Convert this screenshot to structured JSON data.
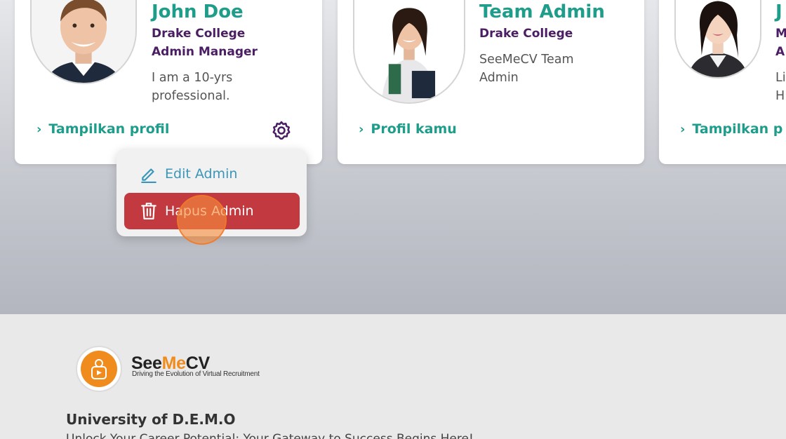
{
  "cards": [
    {
      "name": "John Doe",
      "org": "Drake College",
      "role": "Admin Manager",
      "desc": "I am a 10-yrs professional.",
      "link": "Tampilkan profil"
    },
    {
      "name": "Team Admin",
      "org": "Drake College",
      "role": "",
      "desc": "SeeMeCV Team Admin",
      "link": "Profil kamu"
    },
    {
      "name": "J",
      "org": "M",
      "role": "A",
      "desc": "Li H",
      "link": "Tampilkan p"
    }
  ],
  "menu": {
    "edit_label": "Edit Admin",
    "delete_label": "Hapus Admin"
  },
  "footer": {
    "brand_see": "See",
    "brand_me": "Me",
    "brand_cv": "CV",
    "tagline": "Driving the Evolution of Virtual Recruitment",
    "university": "University of D.E.M.O",
    "slogan": "Unlock Your Career Potential: Your Gateway to Success Begins Here!"
  },
  "colors": {
    "name": "#1f9d8b",
    "org": "#4b1d63",
    "delete_bg": "#c23a3f",
    "edit_text": "#3a96b9",
    "brand_orange": "#f08c1e"
  },
  "icons": {
    "gear": "gear-icon",
    "edit": "pencil-icon",
    "delete": "trash-icon",
    "chevron": "chevron-right-icon"
  }
}
